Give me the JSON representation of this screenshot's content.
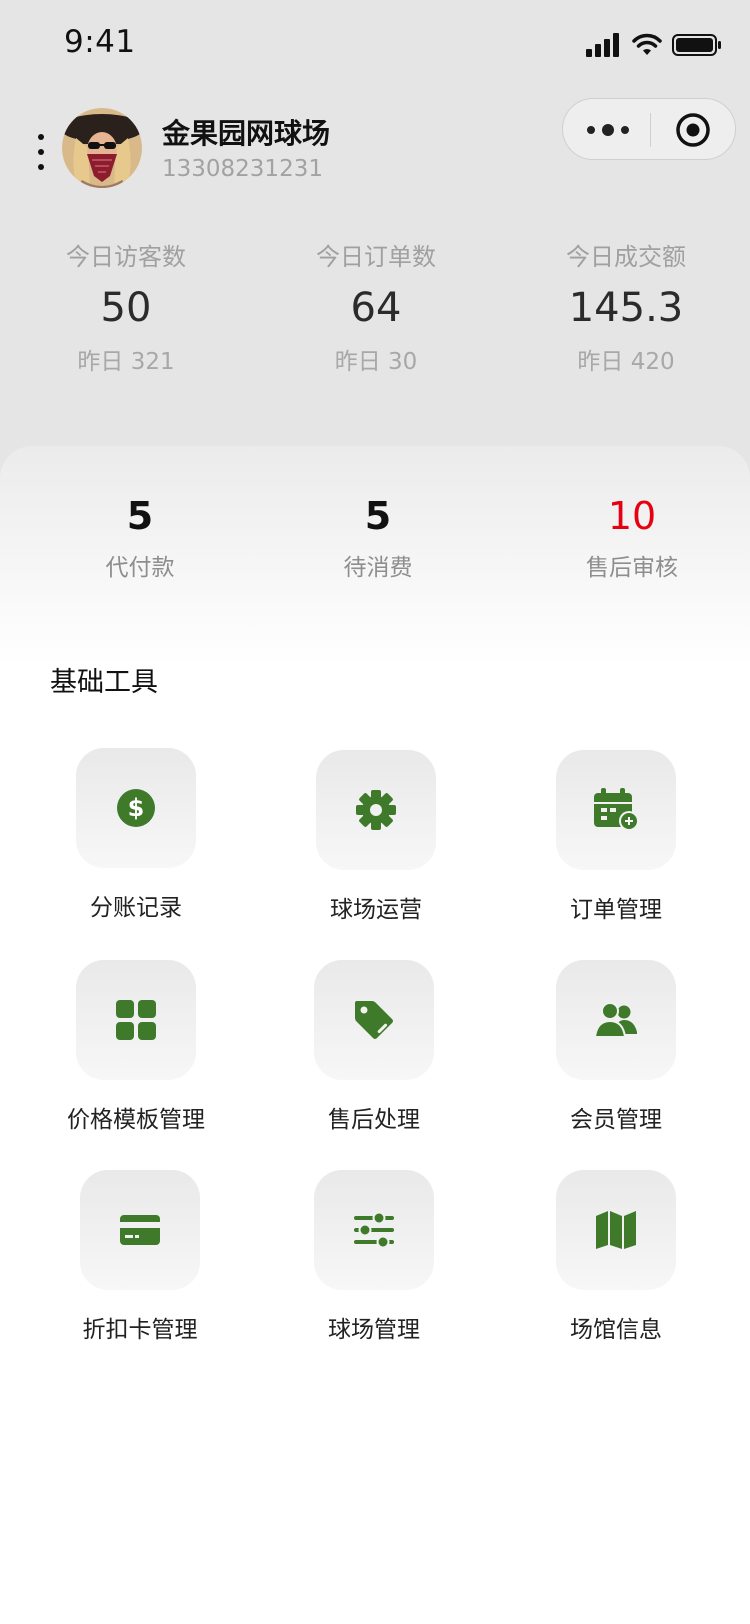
{
  "status_bar": {
    "time": "9:41"
  },
  "header": {
    "title": "金果园网球场",
    "phone": "13308231231"
  },
  "stats": [
    {
      "label": "今日访客数",
      "value": "50",
      "prev": "昨日 321"
    },
    {
      "label": "今日订单数",
      "value": "64",
      "prev": "昨日 30"
    },
    {
      "label": "今日成交额",
      "value": "145.3",
      "prev": "昨日 420"
    }
  ],
  "counts": [
    {
      "value": "5",
      "label": "代付款"
    },
    {
      "value": "5",
      "label": "待消费"
    },
    {
      "value": "10",
      "label": "售后审核"
    }
  ],
  "section": {
    "title": "基础工具"
  },
  "tools": [
    {
      "label": "分账记录",
      "icon": "dollar-icon"
    },
    {
      "label": "球场运营",
      "icon": "gear-icon"
    },
    {
      "label": "订单管理",
      "icon": "calendar-add-icon"
    },
    {
      "label": "价格模板管理",
      "icon": "grid-icon"
    },
    {
      "label": "售后处理",
      "icon": "tag-icon"
    },
    {
      "label": "会员管理",
      "icon": "users-icon"
    },
    {
      "label": "折扣卡管理",
      "icon": "credit-card-icon"
    },
    {
      "label": "球场管理",
      "icon": "sliders-icon"
    },
    {
      "label": "场馆信息",
      "icon": "map-icon"
    }
  ],
  "colors": {
    "accent": "#3f7a2a",
    "alert": "#e60012"
  }
}
